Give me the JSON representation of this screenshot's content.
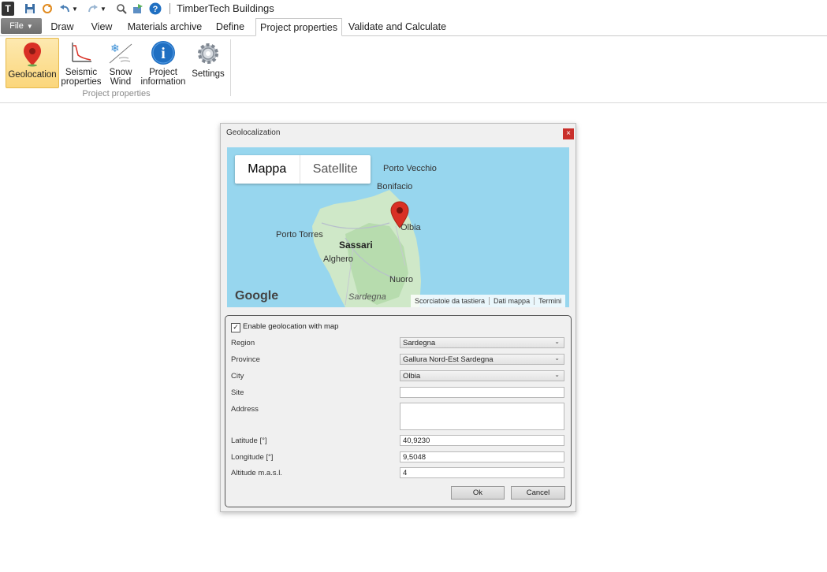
{
  "app": {
    "title": "TimberTech Buildings"
  },
  "quick_access": {
    "icons": [
      "app-logo-icon",
      "save-icon",
      "refresh-icon",
      "undo-icon",
      "redo-icon",
      "search-icon",
      "export-icon",
      "help-icon"
    ]
  },
  "tabs": {
    "file": "File",
    "items": [
      "Draw",
      "View",
      "Materials archive",
      "Define",
      "Project properties",
      "Validate and Calculate"
    ],
    "active": "Project properties"
  },
  "ribbon": {
    "buttons": [
      {
        "label": "Geolocation",
        "icon": "map-pin-icon"
      },
      {
        "label": "Seismic\nproperties",
        "icon": "seismic-graph-icon"
      },
      {
        "label": "Snow\nWind",
        "icon": "snow-wind-icon"
      },
      {
        "label": "Project\ninformation",
        "icon": "info-icon"
      },
      {
        "label": "Settings",
        "icon": "gear-icon"
      }
    ],
    "group_label": "Project properties"
  },
  "dialog": {
    "title": "Geolocalization",
    "close": "×",
    "map": {
      "type_buttons": [
        "Mappa",
        "Satellite"
      ],
      "places": [
        "Porto Vecchio",
        "Bonifacio",
        "Olbia",
        "Porto Torres",
        "Sassari",
        "Alghero",
        "Nuoro",
        "Sardegna"
      ],
      "logo": "Google",
      "attribution": [
        "Scorciatoie da tastiera",
        "Dati mappa",
        "Termini"
      ]
    },
    "form": {
      "enable_label": "Enable geolocation with map",
      "enable_checked": true,
      "region_label": "Region",
      "region_value": "Sardegna",
      "province_label": "Province",
      "province_value": "Gallura Nord-Est Sardegna",
      "city_label": "City",
      "city_value": "Olbia",
      "site_label": "Site",
      "site_value": "",
      "address_label": "Address",
      "address_value": "",
      "latitude_label": "Latitude [°]",
      "latitude_value": "40,9230",
      "longitude_label": "Longitude [°]",
      "longitude_value": "9,5048",
      "altitude_label": "Altitude m.a.s.l.",
      "altitude_value": "4",
      "ok": "Ok",
      "cancel": "Cancel"
    }
  },
  "colors": {
    "accent": "#fbd67b",
    "close": "#c9302c",
    "sea": "#97d6ee",
    "land": "#cfe8c8",
    "pin": "#d93025"
  }
}
